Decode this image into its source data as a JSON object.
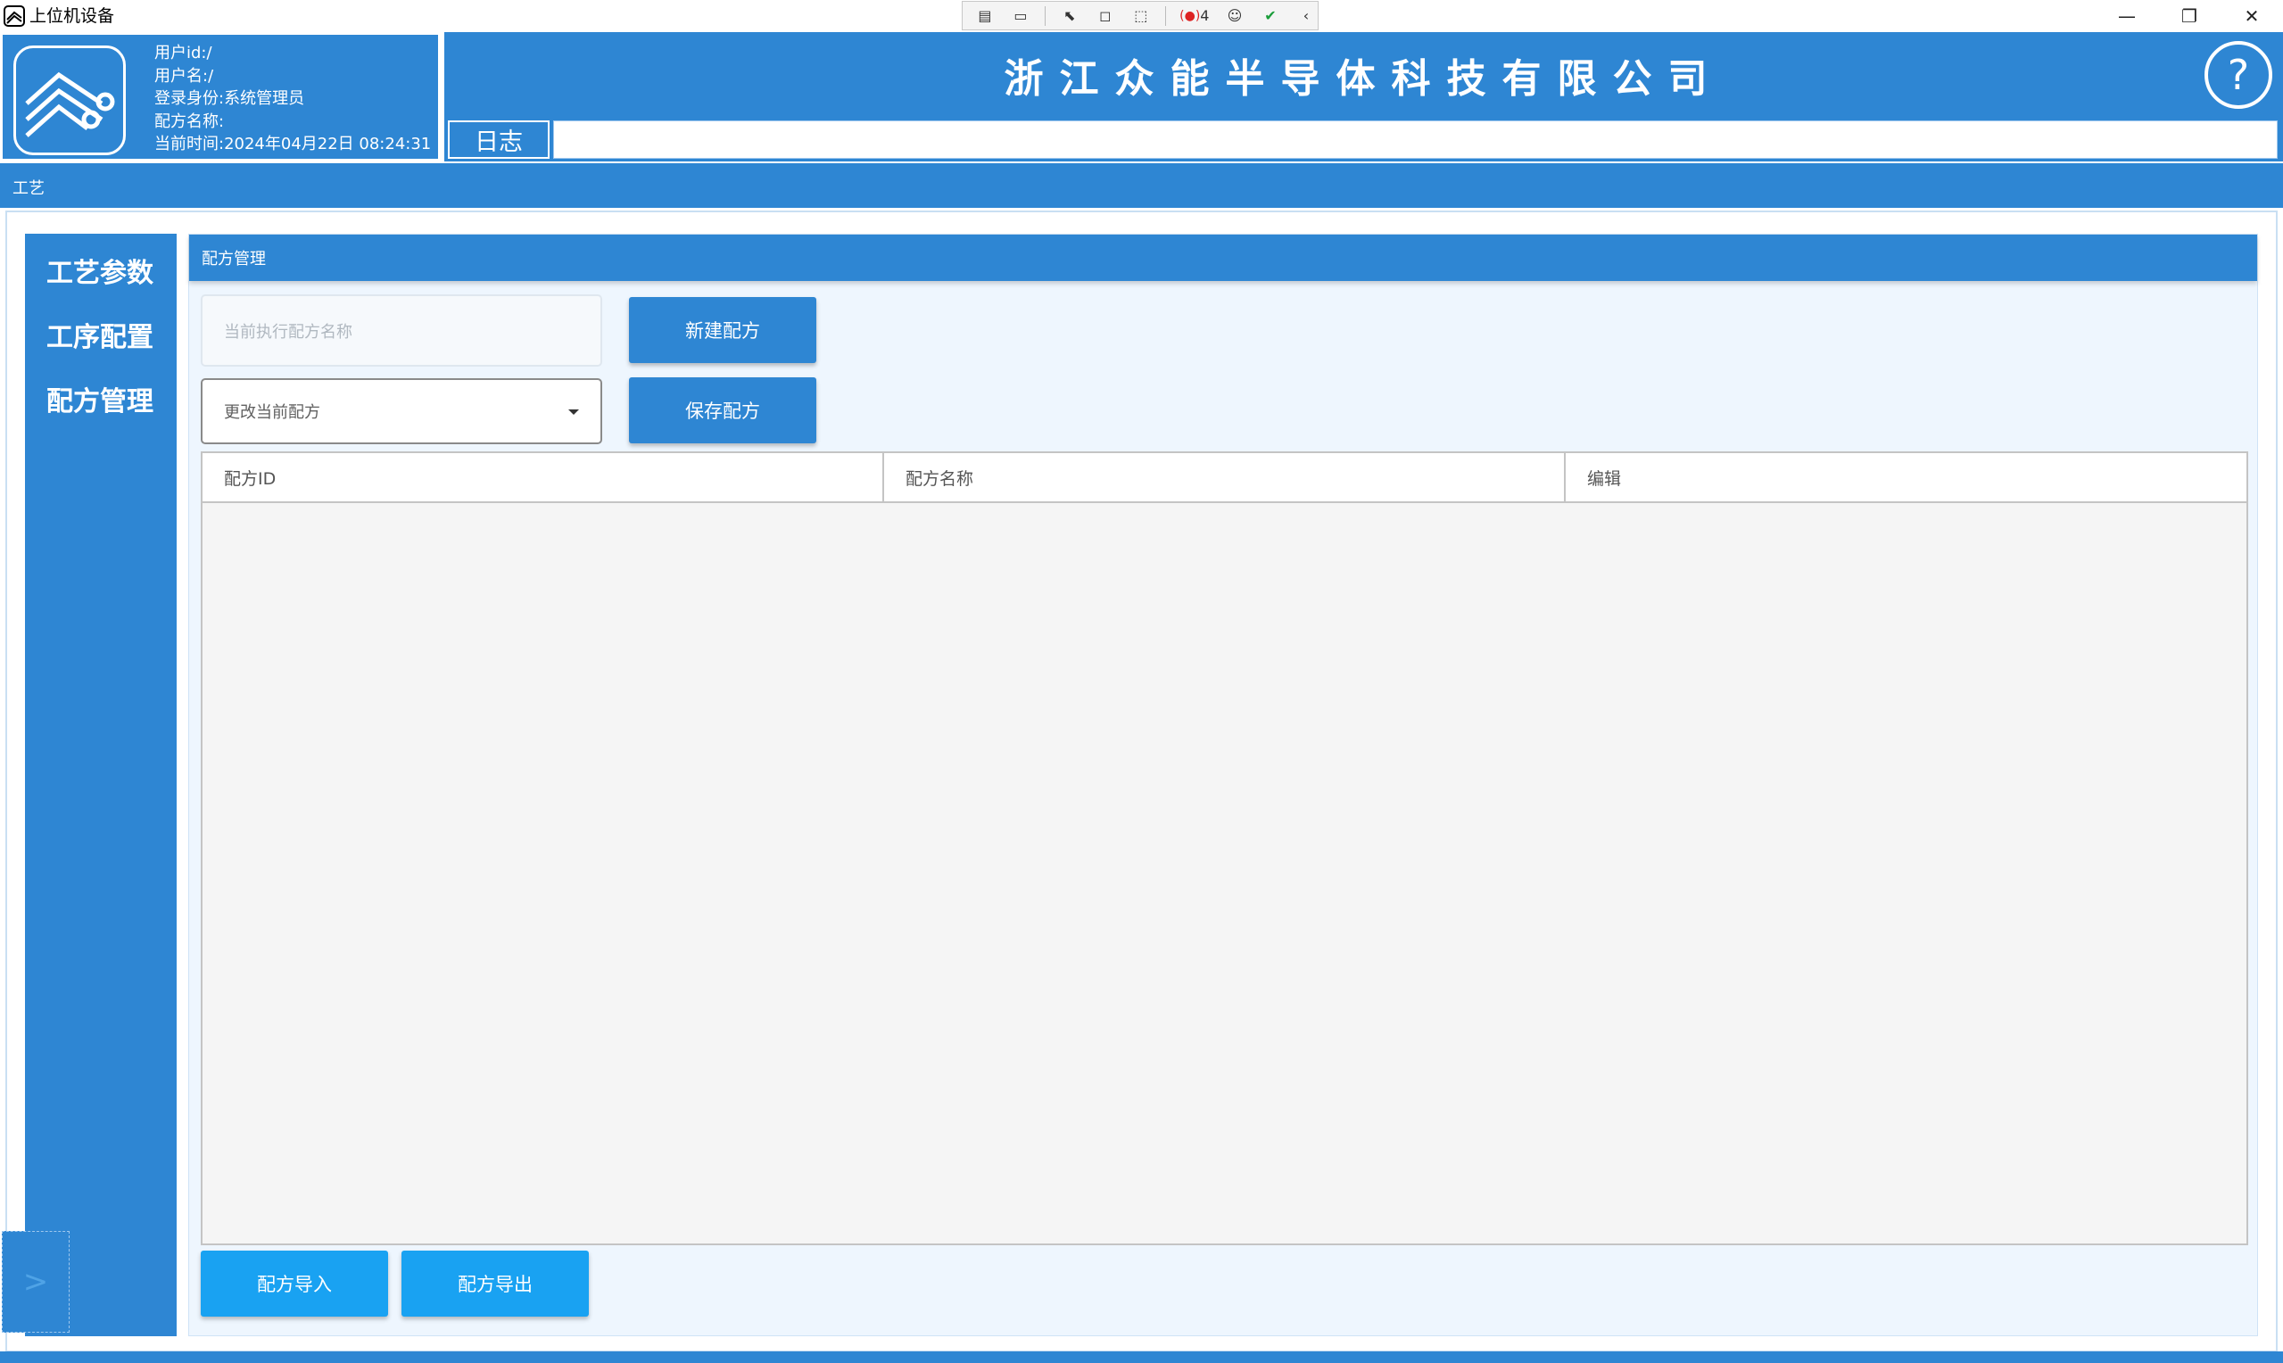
{
  "window": {
    "title": "上位机设备"
  },
  "debug_toolbar": {
    "binding_errors": "4"
  },
  "header": {
    "user_info": [
      "用户id:/",
      "用户名:/",
      "登录身份:系统管理员",
      "配方名称:",
      "当前时间:2024年04月22日 08:24:31"
    ],
    "company_name": "浙江众能半导体科技有限公司",
    "help_label": "?",
    "log_tab_label": "日志"
  },
  "breadcrumb": "工艺",
  "sidebar": {
    "items": [
      {
        "label": "工艺参数"
      },
      {
        "label": "工序配置"
      },
      {
        "label": "配方管理"
      }
    ],
    "toggle_label": ">"
  },
  "panel": {
    "title": "配方管理",
    "current_recipe_placeholder": "当前执行配方名称",
    "change_recipe_label": "更改当前配方",
    "new_recipe_button": "新建配方",
    "save_recipe_button": "保存配方",
    "table": {
      "columns": [
        "配方ID",
        "配方名称",
        "编辑"
      ],
      "rows": []
    },
    "import_button": "配方导入",
    "export_button": "配方导出"
  },
  "colors": {
    "primary": "#2e86d3",
    "accent_button": "#19a2f2",
    "panel_bg": "#eef6fe",
    "table_bg": "#f5f5f5"
  }
}
